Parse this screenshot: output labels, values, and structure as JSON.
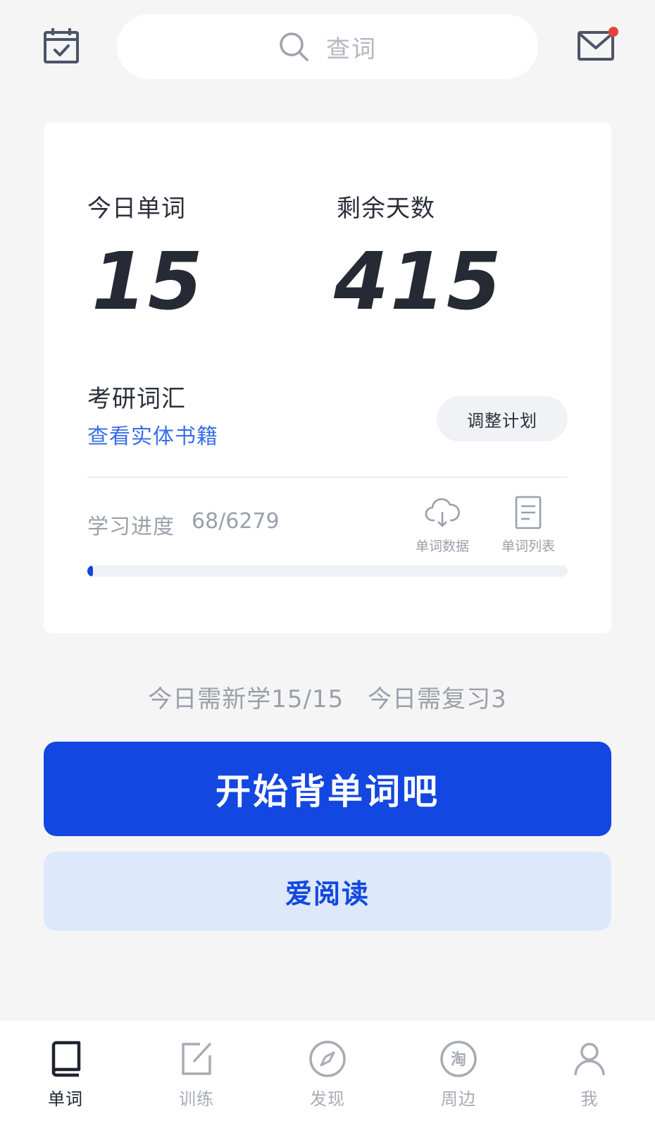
{
  "header": {
    "search_placeholder": "查词"
  },
  "card": {
    "today_words_label": "今日单词",
    "today_words_value": "15",
    "days_left_label": "剩余天数",
    "days_left_value": "415",
    "book_title": "考研词汇",
    "book_link": "查看实体书籍",
    "adjust_plan_label": "调整计划",
    "progress_label": "学习进度",
    "progress_count": "68/6279",
    "progress_fraction": 0.0108,
    "tools": [
      {
        "label": "单词数据",
        "icon": "cloud-download-icon"
      },
      {
        "label": "单词列表",
        "icon": "document-list-icon"
      }
    ]
  },
  "summary": {
    "new_today": "今日需新学15/15",
    "review_today": "今日需复习3"
  },
  "actions": {
    "start_label": "开始背单词吧",
    "read_label": "爱阅读"
  },
  "bottom_nav": [
    {
      "label": "单词",
      "icon": "book-icon",
      "active": true
    },
    {
      "label": "训练",
      "icon": "edit-icon",
      "active": false
    },
    {
      "label": "发现",
      "icon": "compass-icon",
      "active": false
    },
    {
      "label": "周边",
      "icon": "taobao-icon",
      "active": false
    },
    {
      "label": "我",
      "icon": "user-icon",
      "active": false
    }
  ],
  "colors": {
    "primary": "#1347e1",
    "link": "#3a6fe8",
    "secondary_button_bg": "#dde9fb",
    "badge": "#e8423a"
  }
}
